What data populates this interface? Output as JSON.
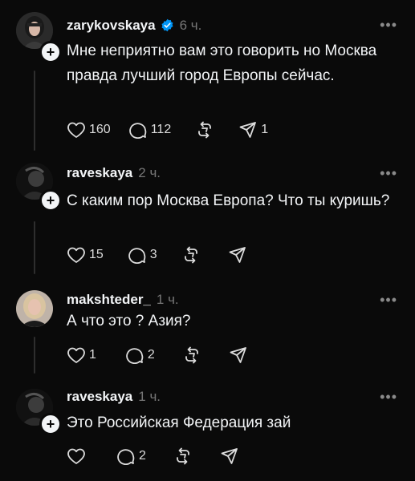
{
  "posts": [
    {
      "username": "zarykovskaya",
      "verified": true,
      "time": "6 ч.",
      "text": "Мне неприятно вам это говорить но Москва правда лучший город Европы сейчас.",
      "likes": "160",
      "comments": "112",
      "reposts": "",
      "shares": "1",
      "avatar_icon": "woman-portrait-avatar"
    },
    {
      "username": "raveskaya",
      "verified": false,
      "time": "2 ч.",
      "text": "С каким пор Москва Европа? Что ты куришь?",
      "likes": "15",
      "comments": "3",
      "reposts": "",
      "shares": "",
      "avatar_icon": "dark-portrait-avatar"
    },
    {
      "username": "makshteder_",
      "verified": false,
      "time": "1 ч.",
      "text": "А что это ? Азия?",
      "likes": "1",
      "comments": "2",
      "reposts": "",
      "shares": "",
      "avatar_icon": "blonde-woman-avatar"
    },
    {
      "username": "raveskaya",
      "verified": false,
      "time": "1 ч.",
      "text": "Это Российская Федерация зай",
      "likes": "",
      "comments": "2",
      "reposts": "",
      "shares": "",
      "avatar_icon": "dark-portrait-avatar"
    }
  ],
  "colors": {
    "background": "#0a0a0a",
    "text": "#f3f5f7",
    "muted": "#777777",
    "verified": "#0095f6"
  }
}
